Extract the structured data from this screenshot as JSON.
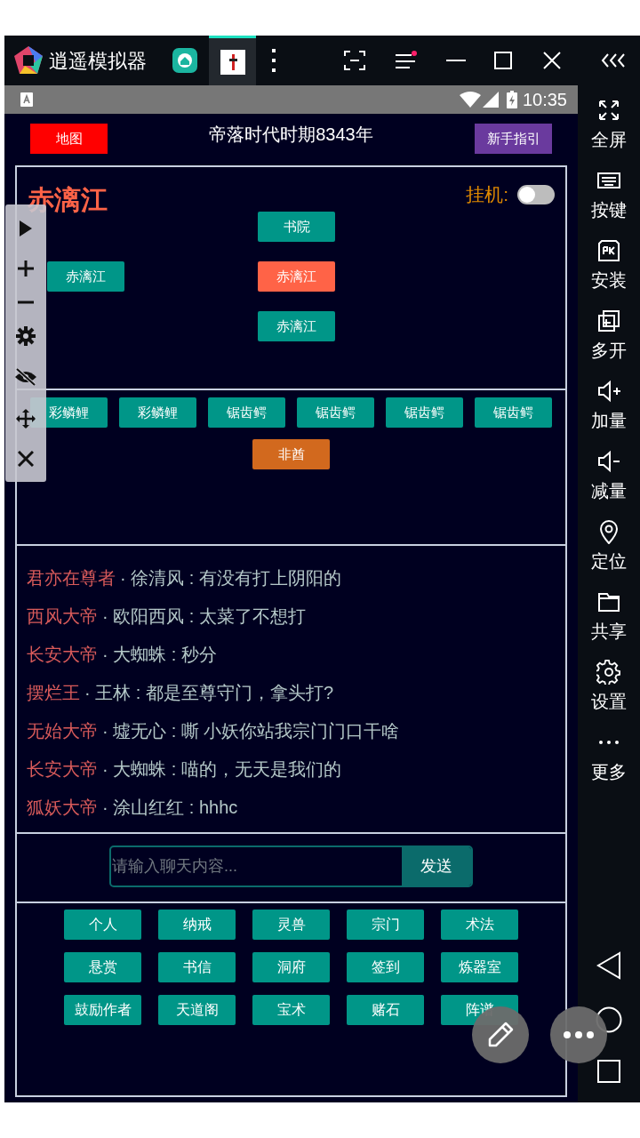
{
  "emulator": {
    "title": "逍遥模拟器"
  },
  "status_bar": {
    "time": "10:35"
  },
  "header": {
    "map_button": "地图",
    "era": "帝落时代时期8343年",
    "guide_button": "新手指引"
  },
  "location": {
    "name": "赤漓江",
    "idle_label": "挂机:",
    "idle_on": false,
    "nodes": [
      {
        "label": "书院",
        "kind": "north",
        "selected": false
      },
      {
        "label": "赤漓江",
        "kind": "west",
        "selected": false
      },
      {
        "label": "赤漓江",
        "kind": "center",
        "selected": true
      },
      {
        "label": "赤漓江",
        "kind": "south",
        "selected": false
      }
    ]
  },
  "entities": [
    {
      "label": "彩鳞鲤",
      "kind": "monster"
    },
    {
      "label": "彩鳞鲤",
      "kind": "monster"
    },
    {
      "label": "锯齿鳄",
      "kind": "monster"
    },
    {
      "label": "锯齿鳄",
      "kind": "monster"
    },
    {
      "label": "锯齿鳄",
      "kind": "monster"
    },
    {
      "label": "锯齿鳄",
      "kind": "monster"
    },
    {
      "label": "非酋",
      "kind": "npc"
    }
  ],
  "chat": [
    {
      "title": "君亦在尊者",
      "text": "· 徐清风 : 有没有打上阴阳的"
    },
    {
      "title": "西风大帝",
      "text": "· 欧阳西风 : 太菜了不想打"
    },
    {
      "title": "长安大帝",
      "text": "· 大蜘蛛 : 秒分"
    },
    {
      "title": "摆烂王",
      "text": "· 王林 : 都是至尊守门，拿头打?"
    },
    {
      "title": "无始大帝",
      "text": "· 墟无心 : 嘶 小妖你站我宗门门口干啥"
    },
    {
      "title": "长安大帝",
      "text": "· 大蜘蛛 : 喵的，无天是我们的"
    },
    {
      "title": "狐妖大帝",
      "text": "· 涂山红红 : hhhc"
    }
  ],
  "chat_input": {
    "placeholder": "请输入聊天内容...",
    "send": "发送"
  },
  "menu": [
    "个人",
    "纳戒",
    "灵兽",
    "宗门",
    "术法",
    "悬赏",
    "书信",
    "洞府",
    "签到",
    "炼器室",
    "鼓励作者",
    "天道阁",
    "宝术",
    "赌石",
    "阵谱"
  ],
  "sidebar": [
    "全屏",
    "按键",
    "安装",
    "多开",
    "加量",
    "减量",
    "定位",
    "共享",
    "设置",
    "更多"
  ]
}
